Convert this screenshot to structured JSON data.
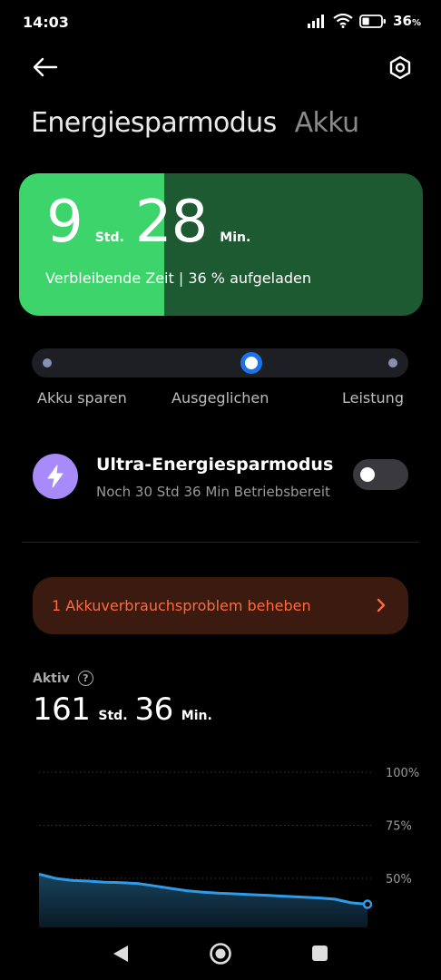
{
  "status_bar": {
    "time": "14:03",
    "battery_percent": "36",
    "battery_percent_suffix": "%",
    "icons": [
      "signal-icon",
      "wifi-icon",
      "battery-icon"
    ]
  },
  "header": {
    "back_icon": "arrow-left-icon",
    "settings_icon": "hexagon-gear-icon"
  },
  "tabs": [
    {
      "label": "Energiesparmodus",
      "active": true
    },
    {
      "label": "Akku",
      "active": false
    }
  ],
  "battery_card": {
    "hours": "9",
    "hours_unit": "Std.",
    "minutes": "28",
    "minutes_unit": "Min.",
    "label": "Verbleibende Zeit | 36 % aufgeladen",
    "charge_fraction": 0.36,
    "fill_color": "#3dd56b",
    "background_color": "#1d5a32"
  },
  "mode_selector": {
    "options": [
      "Akku sparen",
      "Ausgeglichen",
      "Leistung"
    ],
    "selected": "Ausgeglichen",
    "accent_color": "#1a73e8"
  },
  "ultra_mode": {
    "icon": "lightning-bolt-icon",
    "title": "Ultra-Energiesparmodus",
    "subtitle": "Noch 30 Std 36 Min Betriebsbereit",
    "enabled": false
  },
  "issue_banner": {
    "text": "1 Akkuverbrauchsproblem beheben",
    "text_color": "#ff6a3d"
  },
  "active_time": {
    "label": "Aktiv",
    "hours": "161",
    "hours_unit": "Std.",
    "minutes": "36",
    "minutes_unit": "Min."
  },
  "chart_data": {
    "type": "area",
    "y_ticks": [
      "100%",
      "75%",
      "50%"
    ],
    "ylim": [
      30,
      100
    ],
    "grid": true,
    "x": [
      0,
      1,
      2,
      3,
      4,
      5,
      6,
      7,
      8,
      9,
      10,
      11,
      12,
      13,
      14,
      15,
      16,
      17,
      18,
      19,
      20
    ],
    "series": [
      {
        "values": [
          52,
          50,
          49,
          48.7,
          48.2,
          48,
          47.6,
          46.5,
          45.3,
          44.2,
          43.5,
          43,
          42.7,
          42.3,
          42,
          41.6,
          41.2,
          40.8,
          40.2,
          38.5,
          37.8
        ]
      }
    ],
    "line_color": "#2f9be8"
  },
  "nav_bar": {
    "buttons": [
      "back-triangle-icon",
      "home-circle-icon",
      "recents-square-icon"
    ]
  }
}
